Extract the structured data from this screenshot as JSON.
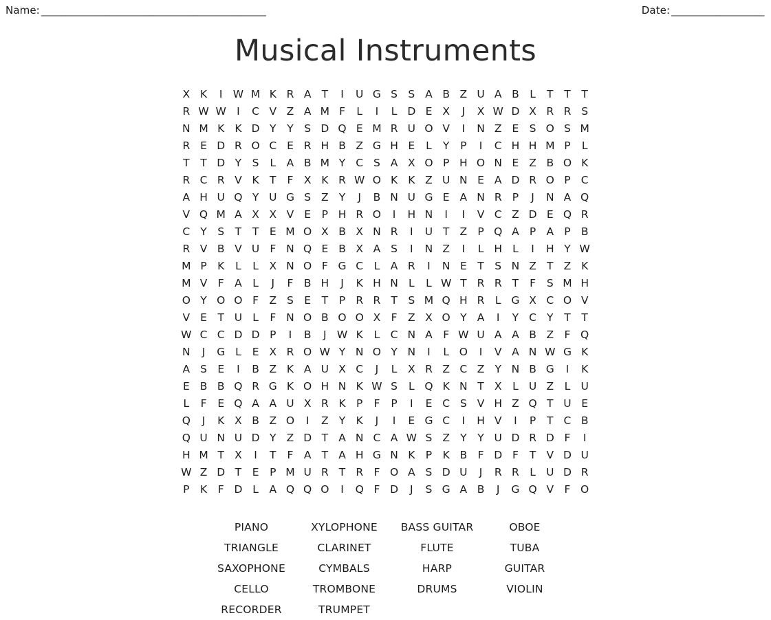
{
  "header": {
    "name_label": "Name:",
    "name_rule": "______________________________________________",
    "name_value": "",
    "date_label": "Date:",
    "date_rule": "___________________",
    "date_value": ""
  },
  "title": "Musical Instruments",
  "puzzle": {
    "rows": 24,
    "columns": 24,
    "grid": [
      "X K I W M K R A T I U G S S A B Z U A B L T T T",
      "R W W I C V Z A M F L I L D E X J X W D X R R S",
      "N M K K D Y Y S D Q E M R U O V I N Z E S O S M",
      "R E D R O C E R H B Z G H E L Y P I C H H M P L",
      "T T D Y S L A B M Y C S A X O P H O N E Z B O K",
      "R C R V K T F X K R W O K K Z U N E A D R O P C",
      "A H U Q Y U G S Z Y J B N U G E A N R P J N A Q",
      "V Q M A X X V E P H R O I H N I I V C Z D E Q R",
      "C Y S T T E M O X B X N R I U T Z P Q A P A P B",
      "R V B V U F N Q E B X A S I N Z I L H L I H Y W",
      "M P K L L X N O F G C L A R I N E T S N Z T Z K",
      "M V F A L J F B H J K H N L L W T R R T F S M H",
      "O Y O O F Z S E T P R R T S M Q H R L G X C O V",
      "V E T U L F N O B O O X F Z X O Y A I Y C Y T T",
      "W C C D D P I B J W K L C N A F W U A A B Z F Q",
      "N J G L E X R O W Y N O Y N I L O I V A N W G K",
      "A S E I B Z K A U X C J L X R Z C Z Y N B G I K",
      "E B B Q R G K O H N K W S L Q K N T X L U Z L U",
      "L F E Q A A U X R K P F P I E C S V H Z Q T U E",
      "Q J K X B Z O I Z Y K J I E G C I H V I P T C B",
      "Q U N U D Y Z D T A N C A W S Z Y Y U D R D F I",
      "H M T X I T F A T A H G N K P K B F D F T V D U",
      "W Z D T E P M U R T R F O A S D U J R R L U D R",
      "P K F D L A Q Q O I Q F D J S G A B J G Q V F O"
    ]
  },
  "word_list": {
    "columns": 4,
    "words": [
      "PIANO",
      "XYLOPHONE",
      "BASS GUITAR",
      "OBOE",
      "TRIANGLE",
      "CLARINET",
      "FLUTE",
      "TUBA",
      "SAXOPHONE",
      "CYMBALS",
      "HARP",
      "GUITAR",
      "CELLO",
      "TROMBONE",
      "DRUMS",
      "VIOLIN",
      "RECORDER",
      "TRUMPET",
      "",
      ""
    ]
  },
  "colors": {
    "page_background": "#ffffff",
    "text": "#1c1c1c",
    "title": "#2b2b2b",
    "rule": "#3a3a3a"
  }
}
